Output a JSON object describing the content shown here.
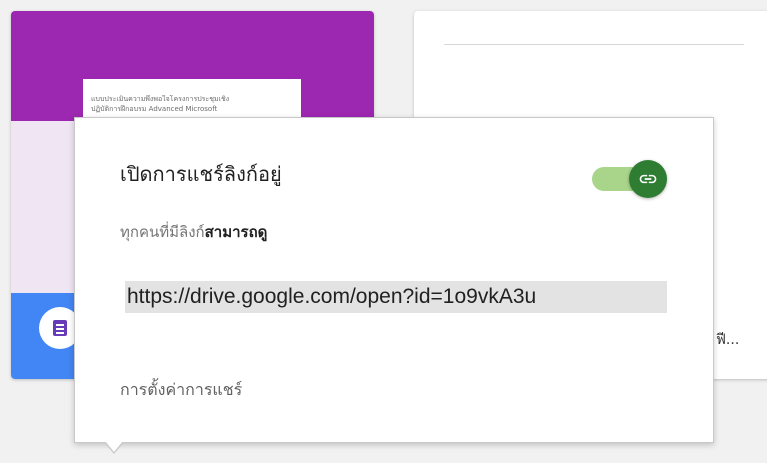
{
  "form_card": {
    "preview_lines": [
      "แบบประเมินความพึงพอใจโครงการประชุมเชิง",
      "ปฏิบัติการฝึกอบรม Advanced Microsoft"
    ],
    "icon": "google-forms-icon"
  },
  "doc_card": {
    "title_fragment": "ฟี..."
  },
  "share_popup": {
    "title": "เปิดการแชร์ลิงก์อยู่",
    "subtitle_prefix": "ทุกคนที่มีลิงก์",
    "subtitle_permission": "สามารถดู",
    "link_url": "https://drive.google.com/open?id=1o9vkA3u",
    "settings_label": "การตั้งค่าการแชร์",
    "toggle": {
      "state": "on",
      "icon": "link-icon",
      "track_color": "#a8d58a",
      "knob_color": "#2e7d32"
    }
  }
}
